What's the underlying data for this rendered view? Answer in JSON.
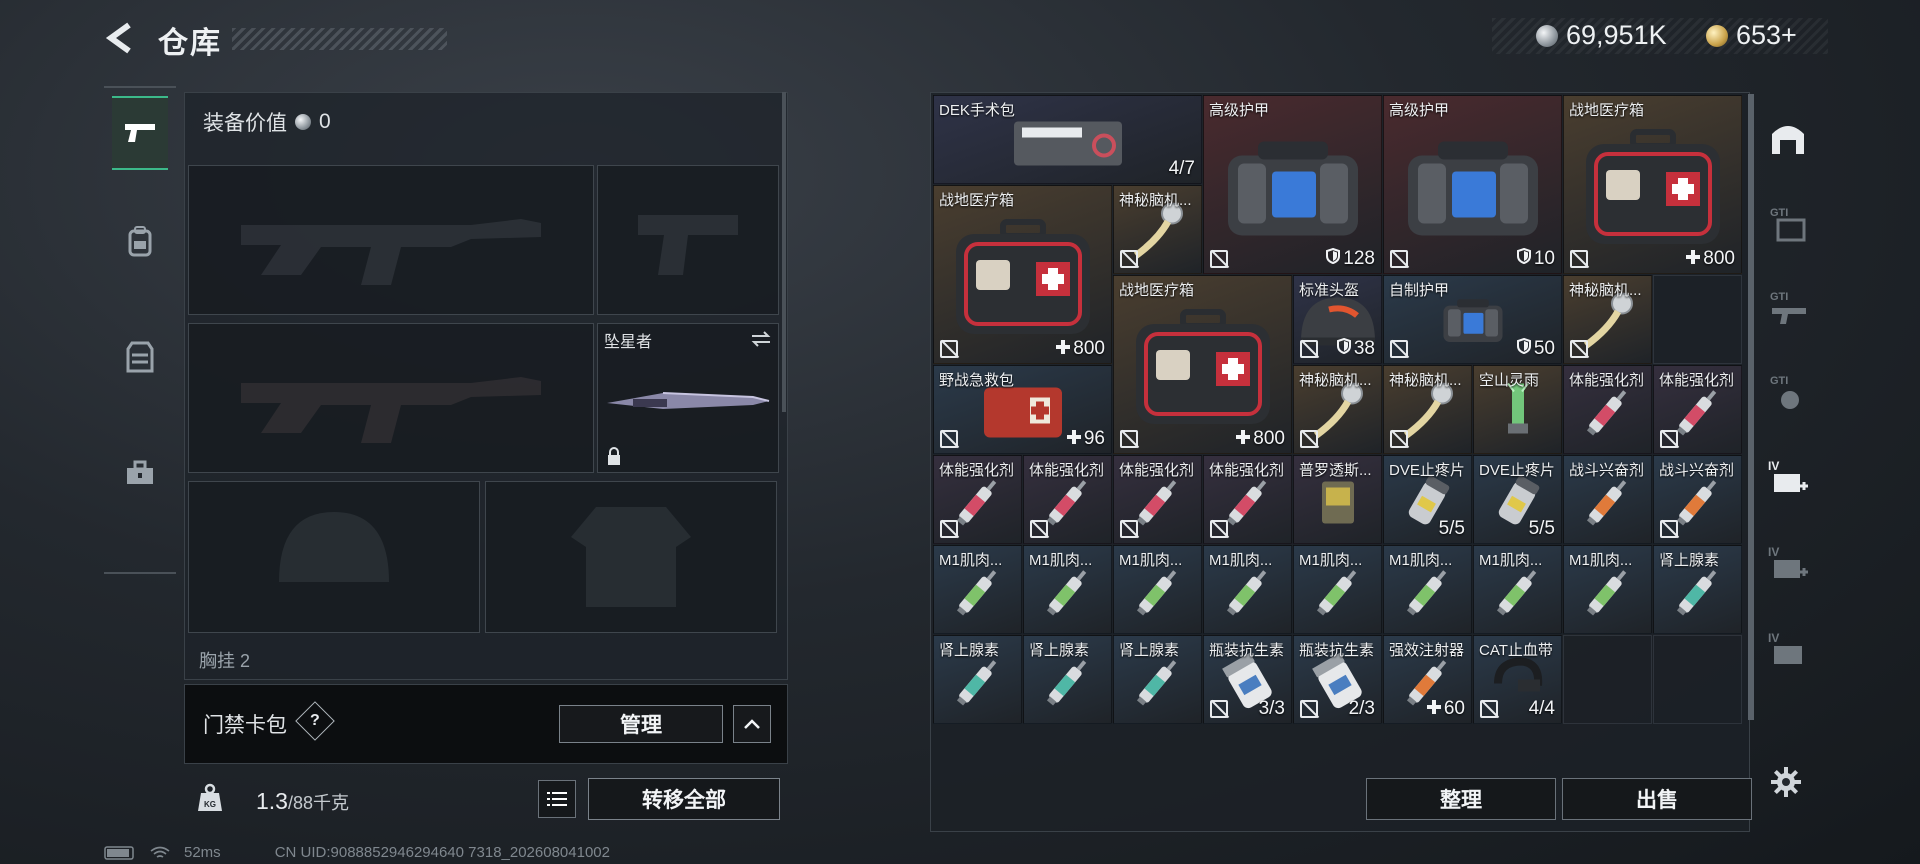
{
  "header": {
    "back_icon": "back-arrow-icon",
    "title": "仓库"
  },
  "currency": {
    "silver": "69,951K",
    "gold": "653+"
  },
  "left_rail": [
    "firearm-icon",
    "backpack-icon",
    "vest-icon",
    "toolbox-icon"
  ],
  "loadout": {
    "equip_value_label": "装备价值",
    "equip_value": "0",
    "melee_slot_name": "坠星者",
    "chest_label": "胸挂",
    "chest_count": "2"
  },
  "card_pack": {
    "label": "门禁卡包",
    "help": "?",
    "manage": "管理"
  },
  "weight": {
    "current": "1.3",
    "capacity": "/88千克"
  },
  "transfer_all": "转移全部",
  "status": {
    "ping": "52ms",
    "uid": "CN UID:9088852946294640 7318_202608041002"
  },
  "storage": {
    "items": [
      {
        "name": "DEK手术包",
        "value": "4/7",
        "kind": "aidkit",
        "bg": "#2f3348",
        "c": 0,
        "r": 0,
        "w": 3,
        "h": 1,
        "ins": false,
        "vicon": ""
      },
      {
        "name": "高级护甲",
        "value": "128",
        "kind": "armor",
        "bg": "#4a2a2e",
        "c": 3,
        "r": 0,
        "w": 2,
        "h": 2,
        "ins": true,
        "vicon": "shield"
      },
      {
        "name": "高级护甲",
        "value": "10",
        "kind": "armor",
        "bg": "#4a2a2e",
        "c": 5,
        "r": 0,
        "w": 2,
        "h": 2,
        "ins": true,
        "vicon": "shield"
      },
      {
        "name": "战地医疗箱",
        "value": "800",
        "kind": "medbox",
        "bg": "#4a3e2f",
        "c": 7,
        "r": 0,
        "w": 2,
        "h": 2,
        "ins": true,
        "vicon": "plus"
      },
      {
        "name": "战地医疗箱",
        "value": "800",
        "kind": "medbox",
        "bg": "#4a3e2f",
        "c": 0,
        "r": 1,
        "w": 2,
        "h": 2,
        "ins": true,
        "vicon": "plus"
      },
      {
        "name": "神秘脑机...",
        "value": "",
        "kind": "brain",
        "bg": "#4a3e2f",
        "c": 2,
        "r": 1,
        "w": 1,
        "h": 1,
        "ins": true,
        "vicon": ""
      },
      {
        "name": "战地医疗箱",
        "value": "800",
        "kind": "medbox",
        "bg": "#4a3e2f",
        "c": 2,
        "r": 2,
        "w": 2,
        "h": 2,
        "ins": true,
        "vicon": "plus"
      },
      {
        "name": "标准头盔",
        "value": "38",
        "kind": "helmet",
        "bg": "#2f3348",
        "c": 4,
        "r": 2,
        "w": 1,
        "h": 1,
        "ins": true,
        "vicon": "shield"
      },
      {
        "name": "自制护甲",
        "value": "50",
        "kind": "armor",
        "bg": "#2b3a4a",
        "c": 5,
        "r": 2,
        "w": 2,
        "h": 1,
        "ins": true,
        "vicon": "shield"
      },
      {
        "name": "神秘脑机...",
        "value": "",
        "kind": "brain",
        "bg": "#4a3e2f",
        "c": 7,
        "r": 2,
        "w": 1,
        "h": 1,
        "ins": true,
        "vicon": ""
      },
      {
        "name": "野战急救包",
        "value": "96",
        "kind": "firstaid",
        "bg": "#2b3a4a",
        "c": 0,
        "r": 3,
        "w": 2,
        "h": 1,
        "ins": true,
        "vicon": "plus"
      },
      {
        "name": "神秘脑机...",
        "value": "",
        "kind": "brain",
        "bg": "#4a3e2f",
        "c": 4,
        "r": 3,
        "w": 1,
        "h": 1,
        "ins": true,
        "vicon": ""
      },
      {
        "name": "神秘脑机...",
        "value": "",
        "kind": "brain",
        "bg": "#4a3e2f",
        "c": 5,
        "r": 3,
        "w": 1,
        "h": 1,
        "ins": true,
        "vicon": ""
      },
      {
        "name": "空山灵雨",
        "value": "",
        "kind": "vial",
        "bg": "#4a3e2f",
        "c": 6,
        "r": 3,
        "w": 1,
        "h": 1,
        "ins": false,
        "vicon": ""
      },
      {
        "name": "体能强化剂",
        "value": "",
        "kind": "inj-red",
        "bg": "#352f3e",
        "c": 7,
        "r": 3,
        "w": 1,
        "h": 1,
        "ins": false,
        "vicon": ""
      },
      {
        "name": "体能强化剂",
        "value": "",
        "kind": "inj-red",
        "bg": "#352f3e",
        "c": 8,
        "r": 3,
        "w": 1,
        "h": 1,
        "ins": true,
        "vicon": ""
      },
      {
        "name": "体能强化剂",
        "value": "",
        "kind": "inj-red",
        "bg": "#352f3e",
        "c": 0,
        "r": 4,
        "w": 1,
        "h": 1,
        "ins": true,
        "vicon": ""
      },
      {
        "name": "体能强化剂",
        "value": "",
        "kind": "inj-red",
        "bg": "#352f3e",
        "c": 1,
        "r": 4,
        "w": 1,
        "h": 1,
        "ins": true,
        "vicon": ""
      },
      {
        "name": "体能强化剂",
        "value": "",
        "kind": "inj-red",
        "bg": "#352f3e",
        "c": 2,
        "r": 4,
        "w": 1,
        "h": 1,
        "ins": true,
        "vicon": ""
      },
      {
        "name": "体能强化剂",
        "value": "",
        "kind": "inj-red",
        "bg": "#352f3e",
        "c": 3,
        "r": 4,
        "w": 1,
        "h": 1,
        "ins": true,
        "vicon": ""
      },
      {
        "name": "普罗透斯...",
        "value": "",
        "kind": "pack",
        "bg": "#352f3e",
        "c": 4,
        "r": 4,
        "w": 1,
        "h": 1,
        "ins": false,
        "vicon": ""
      },
      {
        "name": "DVE止疼片",
        "value": "5/5",
        "kind": "pills",
        "bg": "#2b3a4a",
        "c": 5,
        "r": 4,
        "w": 1,
        "h": 1,
        "ins": false,
        "vicon": ""
      },
      {
        "name": "DVE止疼片",
        "value": "5/5",
        "kind": "pills",
        "bg": "#2b3a4a",
        "c": 6,
        "r": 4,
        "w": 1,
        "h": 1,
        "ins": false,
        "vicon": ""
      },
      {
        "name": "战斗兴奋剂",
        "value": "",
        "kind": "inj-orange",
        "bg": "#2b3a4a",
        "c": 7,
        "r": 4,
        "w": 1,
        "h": 1,
        "ins": false,
        "vicon": ""
      },
      {
        "name": "战斗兴奋剂",
        "value": "",
        "kind": "inj-orange",
        "bg": "#2b3a4a",
        "c": 8,
        "r": 4,
        "w": 1,
        "h": 1,
        "ins": true,
        "vicon": ""
      },
      {
        "name": "M1肌肉...",
        "value": "",
        "kind": "inj-green",
        "bg": "#2b3a4a",
        "c": 0,
        "r": 5,
        "w": 1,
        "h": 1,
        "ins": false,
        "vicon": ""
      },
      {
        "name": "M1肌肉...",
        "value": "",
        "kind": "inj-green",
        "bg": "#2b3a4a",
        "c": 1,
        "r": 5,
        "w": 1,
        "h": 1,
        "ins": false,
        "vicon": ""
      },
      {
        "name": "M1肌肉...",
        "value": "",
        "kind": "inj-green",
        "bg": "#2b3a4a",
        "c": 2,
        "r": 5,
        "w": 1,
        "h": 1,
        "ins": false,
        "vicon": ""
      },
      {
        "name": "M1肌肉...",
        "value": "",
        "kind": "inj-green",
        "bg": "#2b3a4a",
        "c": 3,
        "r": 5,
        "w": 1,
        "h": 1,
        "ins": false,
        "vicon": ""
      },
      {
        "name": "M1肌肉...",
        "value": "",
        "kind": "inj-green",
        "bg": "#2b3a4a",
        "c": 4,
        "r": 5,
        "w": 1,
        "h": 1,
        "ins": false,
        "vicon": ""
      },
      {
        "name": "M1肌肉...",
        "value": "",
        "kind": "inj-green",
        "bg": "#2b3a4a",
        "c": 5,
        "r": 5,
        "w": 1,
        "h": 1,
        "ins": false,
        "vicon": ""
      },
      {
        "name": "M1肌肉...",
        "value": "",
        "kind": "inj-green",
        "bg": "#2b3a4a",
        "c": 6,
        "r": 5,
        "w": 1,
        "h": 1,
        "ins": false,
        "vicon": ""
      },
      {
        "name": "M1肌肉...",
        "value": "",
        "kind": "inj-green",
        "bg": "#2b3a4a",
        "c": 7,
        "r": 5,
        "w": 1,
        "h": 1,
        "ins": false,
        "vicon": ""
      },
      {
        "name": "肾上腺素",
        "value": "",
        "kind": "inj-teal",
        "bg": "#2b3a4a",
        "c": 8,
        "r": 5,
        "w": 1,
        "h": 1,
        "ins": false,
        "vicon": ""
      },
      {
        "name": "肾上腺素",
        "value": "",
        "kind": "inj-teal",
        "bg": "#2b3a4a",
        "c": 0,
        "r": 6,
        "w": 1,
        "h": 1,
        "ins": false,
        "vicon": ""
      },
      {
        "name": "肾上腺素",
        "value": "",
        "kind": "inj-teal",
        "bg": "#2b3a4a",
        "c": 1,
        "r": 6,
        "w": 1,
        "h": 1,
        "ins": false,
        "vicon": ""
      },
      {
        "name": "肾上腺素",
        "value": "",
        "kind": "inj-teal",
        "bg": "#2b3a4a",
        "c": 2,
        "r": 6,
        "w": 1,
        "h": 1,
        "ins": false,
        "vicon": ""
      },
      {
        "name": "瓶装抗生素",
        "value": "3/3",
        "kind": "bottle",
        "bg": "#2b3a4a",
        "c": 3,
        "r": 6,
        "w": 1,
        "h": 1,
        "ins": true,
        "vicon": ""
      },
      {
        "name": "瓶装抗生素",
        "value": "2/3",
        "kind": "bottle",
        "bg": "#2b3a4a",
        "c": 4,
        "r": 6,
        "w": 1,
        "h": 1,
        "ins": true,
        "vicon": ""
      },
      {
        "name": "强效注射器",
        "value": "60",
        "kind": "inj-orange",
        "bg": "#2b3a4a",
        "c": 5,
        "r": 6,
        "w": 1,
        "h": 1,
        "ins": false,
        "vicon": "plus"
      },
      {
        "name": "CAT止血带",
        "value": "4/4",
        "kind": "tourniquet",
        "bg": "#2b3a4a",
        "c": 6,
        "r": 6,
        "w": 1,
        "h": 1,
        "ins": true,
        "vicon": ""
      }
    ]
  },
  "actions": {
    "sort": "整理",
    "sell": "出售"
  },
  "right_rail": [
    "GTI",
    "GTI",
    "GTI",
    "IV",
    "IV",
    "IV"
  ]
}
